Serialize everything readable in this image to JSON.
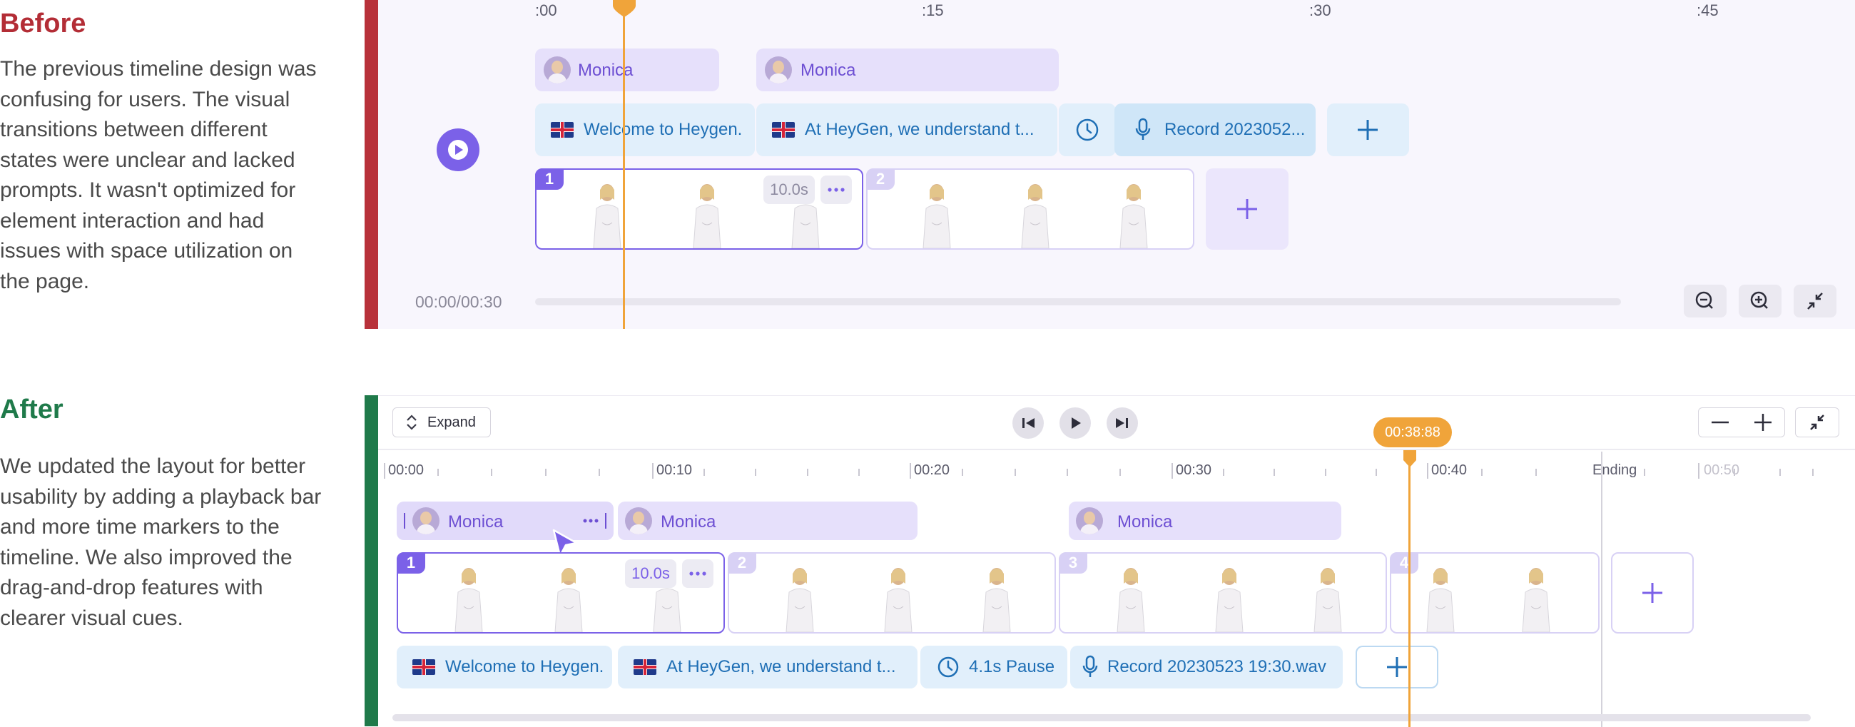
{
  "before": {
    "heading": "Before",
    "description": "The previous timeline design was confusing for users. The visual transitions between different states were unclear and lacked prompts. It wasn't optimized for element interaction and had issues with space utilization on the page.",
    "time_labels": [
      ":00",
      ":15",
      ":30",
      ":45"
    ],
    "avatar_clips": [
      {
        "label": "Monica"
      },
      {
        "label": "Monica"
      }
    ],
    "script_clips": [
      {
        "text": "Welcome to Heygen."
      },
      {
        "text": "At HeyGen, we understand t..."
      },
      {
        "text": "Record 2023052..."
      }
    ],
    "scenes": [
      {
        "number": "1",
        "duration": "10.0s"
      },
      {
        "number": "2"
      }
    ],
    "time_display": "00:00/00:30",
    "icons": [
      "play-icon",
      "clock-icon",
      "mic-icon",
      "plus-icon",
      "more-icon",
      "zoom-out-icon",
      "zoom-in-icon",
      "collapse-icon"
    ]
  },
  "after": {
    "heading": "After",
    "description": "We updated the layout for better usability by adding a playback bar and more time markers to the timeline. We also improved the drag-and-drop features with clearer visual cues.",
    "expand_label": "Expand",
    "playhead_time": "00:38:88",
    "ruler_labels": [
      "00:00",
      "00:10",
      "00:20",
      "00:30",
      "00:40",
      "Ending",
      "00:50"
    ],
    "avatar_clips": [
      {
        "label": "Monica"
      },
      {
        "label": "Monica"
      },
      {
        "label": "Monica"
      }
    ],
    "scenes": [
      {
        "number": "1",
        "duration": "10.0s"
      },
      {
        "number": "2"
      },
      {
        "number": "3"
      },
      {
        "number": "4"
      }
    ],
    "script_clips": [
      {
        "text": "Welcome to Heygen."
      },
      {
        "text": "At HeyGen, we understand t..."
      },
      {
        "text": "4.1s Pause"
      },
      {
        "text": "Record 20230523 19:30.wav"
      }
    ],
    "icons": [
      "expand-arrows-icon",
      "skip-back-icon",
      "play-icon",
      "skip-forward-icon",
      "zoom-out-icon",
      "zoom-in-icon",
      "collapse-icon",
      "cursor-icon",
      "clock-icon",
      "mic-icon",
      "plus-icon",
      "more-icon"
    ]
  },
  "colors": {
    "before_accent": "#b8313a",
    "after_accent": "#1f7a4a",
    "playhead": "#f0a43a",
    "purple": "#7b61e8",
    "script_blue": "#1f6fb5"
  }
}
